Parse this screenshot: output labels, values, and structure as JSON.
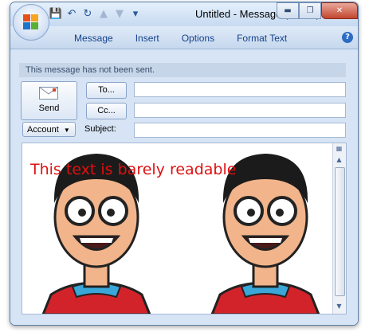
{
  "window": {
    "title": "Untitled - Message (HTML)",
    "minimize_icon": "minimize-icon",
    "maximize_icon": "restore-icon",
    "close_icon": "close-icon"
  },
  "quick_access": [
    "save-icon",
    "undo-icon",
    "redo-icon",
    "previous-item-icon",
    "next-item-icon",
    "customize-qat-icon"
  ],
  "ribbon": {
    "tabs": [
      "Message",
      "Insert",
      "Options",
      "Format Text"
    ],
    "help_label": "?"
  },
  "compose": {
    "notice": "This message has not been sent.",
    "send_label": "Send",
    "to_label": "To...",
    "cc_label": "Cc...",
    "account_label": "Account",
    "subject_label": "Subject:",
    "to_value": "",
    "cc_value": "",
    "subject_value": ""
  },
  "message_body": {
    "text": "This text is barely readable",
    "text_color": "#e01010",
    "image_count": 2
  },
  "colors": {
    "accent": "#15428b",
    "frame": "#d4e3f4"
  }
}
